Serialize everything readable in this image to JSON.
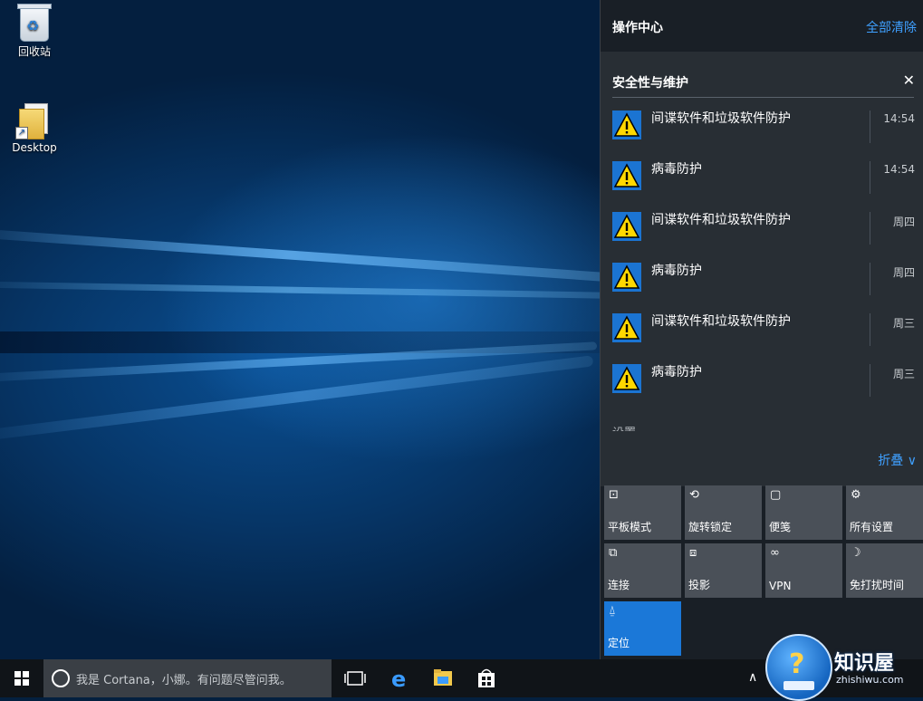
{
  "desktop": {
    "icons": [
      {
        "label": "回收站",
        "icon": "recycle-bin-icon"
      },
      {
        "label": "Desktop",
        "icon": "desktop-shortcut-icon"
      }
    ]
  },
  "action_center": {
    "title": "操作中心",
    "clear_all": "全部清除",
    "group": {
      "title": "安全性与维护",
      "close": "✕",
      "notifications": [
        {
          "text": "间谍软件和垃圾软件防护",
          "time": "14:54"
        },
        {
          "text": "病毒防护",
          "time": "14:54"
        },
        {
          "text": "间谍软件和垃圾软件防护",
          "time": "周四"
        },
        {
          "text": "病毒防护",
          "time": "周四"
        },
        {
          "text": "间谍软件和垃圾软件防护",
          "time": "周三"
        },
        {
          "text": "病毒防护",
          "time": "周三"
        }
      ],
      "peek_text": "设置"
    },
    "collapse": "折叠 ∨",
    "quick_actions": [
      {
        "label": "平板模式",
        "icon": "tablet-mode-icon",
        "glyph": "⊡"
      },
      {
        "label": "旋转锁定",
        "icon": "rotation-lock-icon",
        "glyph": "⟲"
      },
      {
        "label": "便笺",
        "icon": "note-icon",
        "glyph": "▢"
      },
      {
        "label": "所有设置",
        "icon": "settings-gear-icon",
        "glyph": "⚙"
      },
      {
        "label": "连接",
        "icon": "connect-icon",
        "glyph": "⧉"
      },
      {
        "label": "投影",
        "icon": "project-icon",
        "glyph": "⧈"
      },
      {
        "label": "VPN",
        "icon": "vpn-icon",
        "glyph": "∞"
      },
      {
        "label": "免打扰时间",
        "icon": "quiet-hours-moon-icon",
        "glyph": "☽"
      },
      {
        "label": "定位",
        "icon": "location-icon",
        "glyph": "⍙",
        "active": true
      }
    ]
  },
  "taskbar": {
    "search_placeholder": "我是 Cortana，小娜。有问题尽管问我。",
    "tray_chevron": "∧"
  },
  "watermark": {
    "title": "知识屋",
    "url": "zhishiwu.com"
  },
  "colors": {
    "accent": "#1b78d8",
    "link": "#3fa0ff",
    "panel": "#1a1f25",
    "warning": "#ffd800"
  }
}
